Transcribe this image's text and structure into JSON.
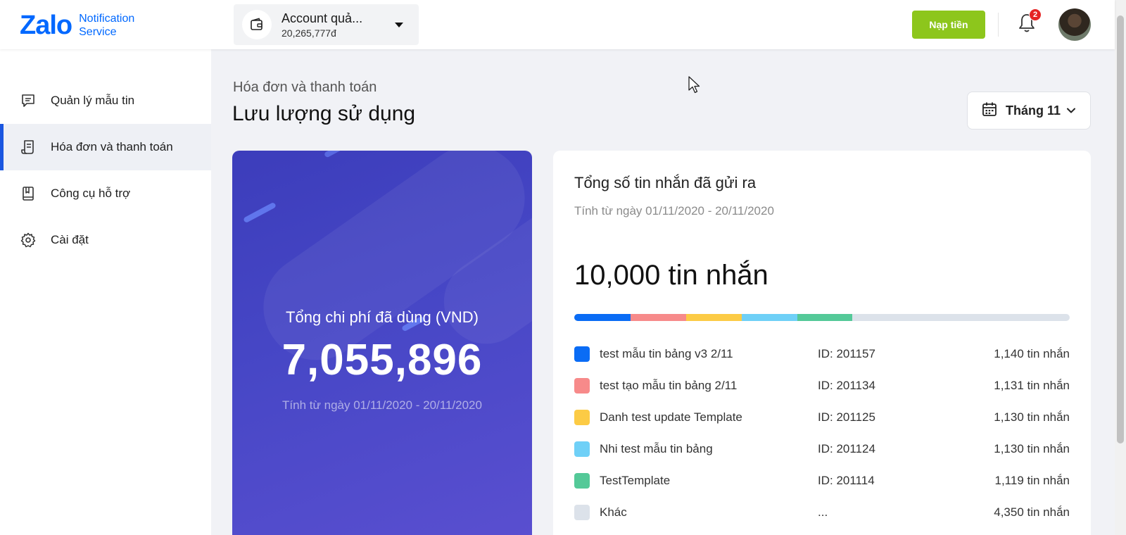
{
  "logo": {
    "brand": "Zalo",
    "sub_line1": "Notification",
    "sub_line2": "Service"
  },
  "account": {
    "name": "Account quả...",
    "balance": "20,265,777đ",
    "icon": "wallet-icon"
  },
  "header": {
    "topup_label": "Nạp tiền",
    "notification_count": "2",
    "icons": [
      "bell-icon",
      "avatar"
    ]
  },
  "sidebar": {
    "items": [
      {
        "label": "Quản lý mẫu tin",
        "icon": "message-template-icon",
        "active": false
      },
      {
        "label": "Hóa đơn và thanh toán",
        "icon": "receipt-icon",
        "active": true
      },
      {
        "label": "Công cụ hỗ trợ",
        "icon": "book-icon",
        "active": false
      },
      {
        "label": "Cài đặt",
        "icon": "gear-icon",
        "active": false
      }
    ]
  },
  "page": {
    "breadcrumb": "Hóa đơn và thanh toán",
    "title": "Lưu lượng sử dụng",
    "month_filter": "Tháng 11"
  },
  "cost_card": {
    "title": "Tổng chi phí đã dùng (VND)",
    "value": "7,055,896",
    "range": "Tính từ ngày 01/11/2020 - 20/11/2020"
  },
  "messages_card": {
    "title": "Tổng số tin nhắn đã gửi ra",
    "range": "Tính từ ngày 01/11/2020 - 20/11/2020",
    "total": "10,000 tin nhắn",
    "templates": [
      {
        "name": "test mẫu tin bảng v3 2/11",
        "id": "ID: 201157",
        "count": "1,140 tin nhắn",
        "color": "#0a6cf5"
      },
      {
        "name": "test tạo mẫu tin bảng 2/11",
        "id": "ID: 201134",
        "count": "1,131 tin nhắn",
        "color": "#f78a8a"
      },
      {
        "name": "Danh test update Template",
        "id": "ID: 201125",
        "count": "1,130 tin nhắn",
        "color": "#fccb45"
      },
      {
        "name": "Nhi test mẫu tin bảng",
        "id": "ID: 201124",
        "count": "1,130 tin nhắn",
        "color": "#6fd0f7"
      },
      {
        "name": "TestTemplate",
        "id": "ID: 201114",
        "count": "1,119 tin nhắn",
        "color": "#54c998"
      },
      {
        "name": "Khác",
        "id": "...",
        "count": "4,350 tin nhắn",
        "color": "#dce2ea"
      }
    ]
  }
}
